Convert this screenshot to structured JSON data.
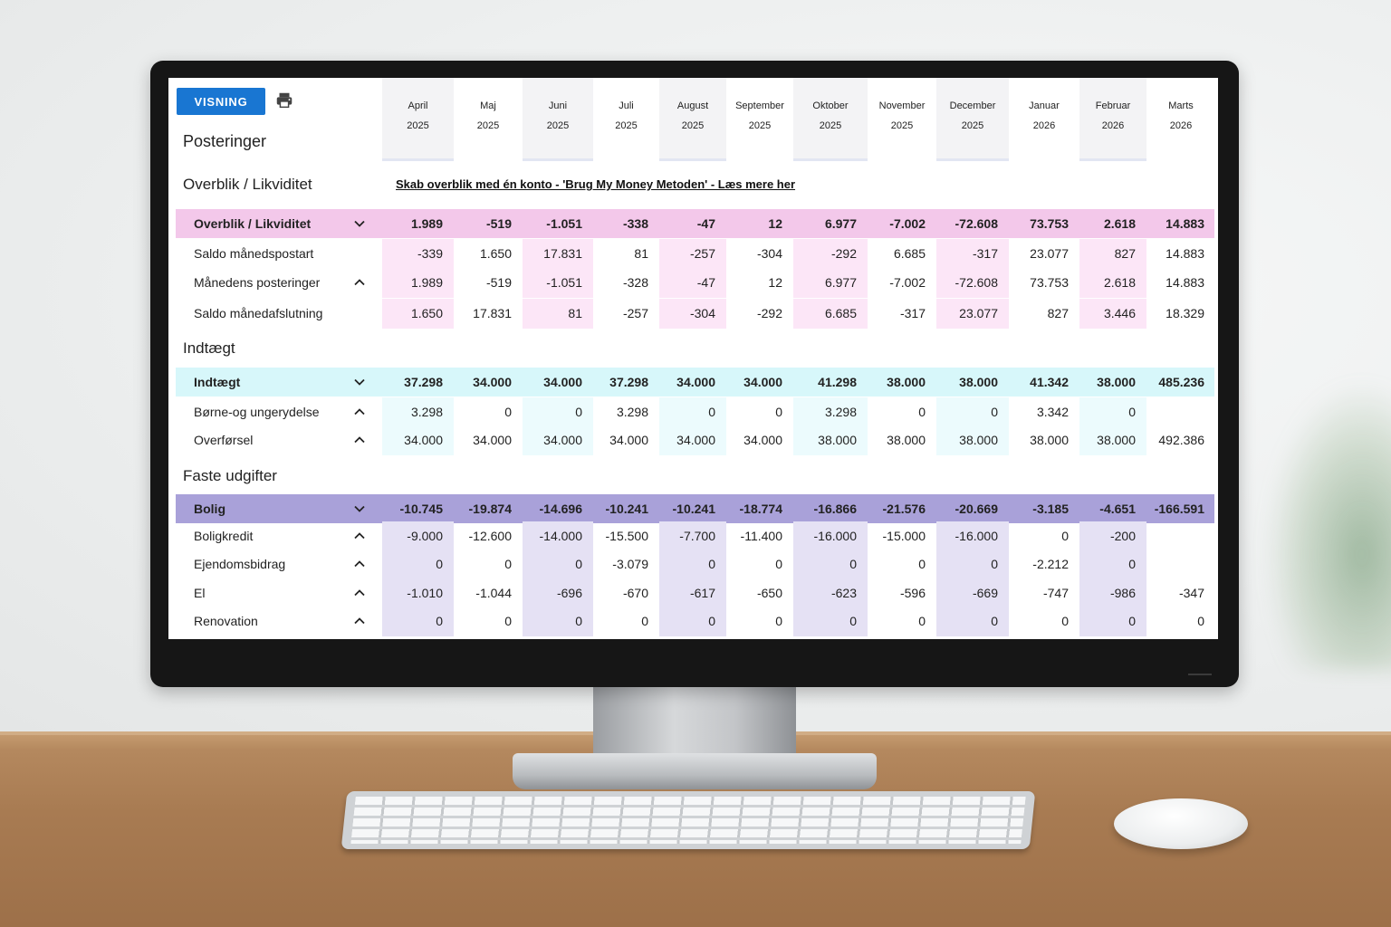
{
  "header": {
    "view_button": "VISNING",
    "print_icon": "printer-icon",
    "title": "Posteringer"
  },
  "months": [
    {
      "month": "April",
      "year": "2025"
    },
    {
      "month": "Maj",
      "year": "2025"
    },
    {
      "month": "Juni",
      "year": "2025"
    },
    {
      "month": "Juli",
      "year": "2025"
    },
    {
      "month": "August",
      "year": "2025"
    },
    {
      "month": "September",
      "year": "2025"
    },
    {
      "month": "Oktober",
      "year": "2025"
    },
    {
      "month": "November",
      "year": "2025"
    },
    {
      "month": "December",
      "year": "2025"
    },
    {
      "month": "Januar",
      "year": "2026"
    },
    {
      "month": "Februar",
      "year": "2026"
    },
    {
      "month": "Marts",
      "year": "2026"
    }
  ],
  "sections": {
    "overview": {
      "title": "Overblik / Likviditet",
      "link": "Skab overblik med én konto - 'Brug My Money Metoden' - Læs mere her",
      "head": {
        "label": "Overblik / Likviditet",
        "values": [
          "1.989",
          "-519",
          "-1.051",
          "-338",
          "-47",
          "12",
          "6.977",
          "-7.002",
          "-72.608",
          "73.753",
          "2.618",
          "14.883"
        ]
      },
      "rows": [
        {
          "label": "Saldo månedspostart",
          "values": [
            "-339",
            "1.650",
            "17.831",
            "81",
            "-257",
            "-304",
            "-292",
            "6.685",
            "-317",
            "23.077",
            "827",
            "14.883"
          ]
        },
        {
          "label": "Månedens posteringer",
          "values": [
            "1.989",
            "-519",
            "-1.051",
            "-328",
            "-47",
            "12",
            "6.977",
            "-7.002",
            "-72.608",
            "73.753",
            "2.618",
            "14.883"
          ]
        },
        {
          "label": "Saldo månedafslutning",
          "values": [
            "1.650",
            "17.831",
            "81",
            "-257",
            "-304",
            "-292",
            "6.685",
            "-317",
            "23.077",
            "827",
            "3.446",
            "18.329"
          ]
        }
      ]
    },
    "income": {
      "title": "Indtægt",
      "head": {
        "label": "Indtægt",
        "values": [
          "37.298",
          "34.000",
          "34.000",
          "37.298",
          "34.000",
          "34.000",
          "41.298",
          "38.000",
          "38.000",
          "41.342",
          "38.000",
          "485.236"
        ]
      },
      "rows": [
        {
          "label": "Børne-og ungerydelse",
          "values": [
            "3.298",
            "0",
            "0",
            "3.298",
            "0",
            "0",
            "3.298",
            "0",
            "0",
            "3.342",
            "0",
            ""
          ]
        },
        {
          "label": "Overførsel",
          "values": [
            "34.000",
            "34.000",
            "34.000",
            "34.000",
            "34.000",
            "34.000",
            "38.000",
            "38.000",
            "38.000",
            "38.000",
            "38.000",
            "492.386"
          ]
        }
      ]
    },
    "fixed": {
      "title": "Faste udgifter",
      "head": {
        "label": "Bolig",
        "values": [
          "-10.745",
          "-19.874",
          "-14.696",
          "-10.241",
          "-10.241",
          "-18.774",
          "-16.866",
          "-21.576",
          "-20.669",
          "-3.185",
          "-4.651",
          "-166.591"
        ]
      },
      "rows": [
        {
          "label": "Boligkredit",
          "values": [
            "-9.000",
            "-12.600",
            "-14.000",
            "-15.500",
            "-7.700",
            "-11.400",
            "-16.000",
            "-15.000",
            "-16.000",
            "0",
            "-200",
            ""
          ]
        },
        {
          "label": "Ejendomsbidrag",
          "values": [
            "0",
            "0",
            "0",
            "-3.079",
            "0",
            "0",
            "0",
            "0",
            "0",
            "-2.212",
            "0",
            ""
          ]
        },
        {
          "label": "El",
          "values": [
            "-1.010",
            "-1.044",
            "-696",
            "-670",
            "-617",
            "-650",
            "-623",
            "-596",
            "-669",
            "-747",
            "-986",
            "-347"
          ]
        },
        {
          "label": "Renovation",
          "values": [
            "0",
            "0",
            "0",
            "0",
            "0",
            "0",
            "0",
            "0",
            "0",
            "0",
            "0",
            "0"
          ]
        }
      ]
    }
  },
  "colors": {
    "accent": "#1976d2",
    "overview_head": "#f3c8ea",
    "income_head": "#d7f7fa",
    "fixed_head": "#a9a1d9"
  }
}
